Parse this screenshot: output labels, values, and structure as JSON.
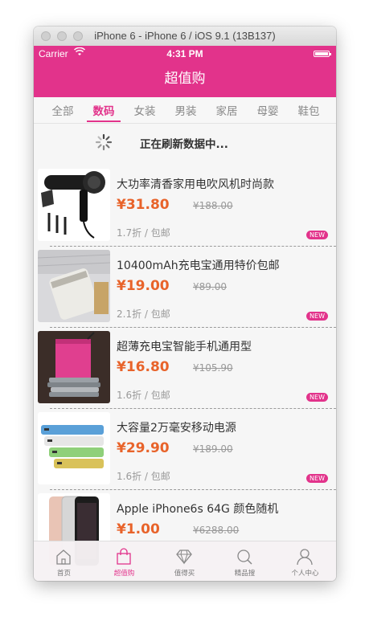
{
  "window": {
    "title": "iPhone 6 - iPhone 6 / iOS 9.1 (13B137)"
  },
  "status_bar": {
    "carrier": "Carrier",
    "time": "4:31 PM"
  },
  "nav": {
    "title": "超值购"
  },
  "categories": {
    "items": [
      "全部",
      "数码",
      "女装",
      "男装",
      "家居",
      "母婴",
      "鞋包"
    ],
    "active_index": 1
  },
  "refresh": {
    "text": "正在刷新数据中..."
  },
  "products": [
    {
      "title": "大功率清香家用电吹风机时尚款",
      "price": "¥31.80",
      "original_price": "¥188.00",
      "discount": "1.7折 / 包邮",
      "badge": "NEW",
      "image": "hair-dryer"
    },
    {
      "title": "10400mAh充电宝通用特价包邮",
      "price": "¥19.00",
      "original_price": "¥89.00",
      "discount": "2.1折 / 包邮",
      "badge": "NEW",
      "image": "power-bank-white"
    },
    {
      "title": "超薄充电宝智能手机通用型",
      "price": "¥16.80",
      "original_price": "¥105.90",
      "discount": "1.6折 / 包邮",
      "badge": "NEW",
      "image": "power-bank-pink"
    },
    {
      "title": "大容量2万毫安移动电源",
      "price": "¥29.90",
      "original_price": "¥189.00",
      "discount": "1.6折 / 包邮",
      "badge": "NEW",
      "image": "power-bank-stack"
    },
    {
      "title": "Apple iPhone6s 64G 颜色随机",
      "price": "¥1.00",
      "original_price": "¥6288.00",
      "discount": "",
      "badge": "",
      "image": "iphone"
    }
  ],
  "tab_bar": {
    "items": [
      {
        "label": "首页",
        "icon": "home-icon"
      },
      {
        "label": "超值购",
        "icon": "shopping-bag-icon"
      },
      {
        "label": "值得买",
        "icon": "diamond-icon"
      },
      {
        "label": "精品搜",
        "icon": "search-icon"
      },
      {
        "label": "个人中心",
        "icon": "person-icon"
      }
    ],
    "active_index": 1
  },
  "colors": {
    "accent": "#e2338b",
    "price": "#e8632a"
  }
}
